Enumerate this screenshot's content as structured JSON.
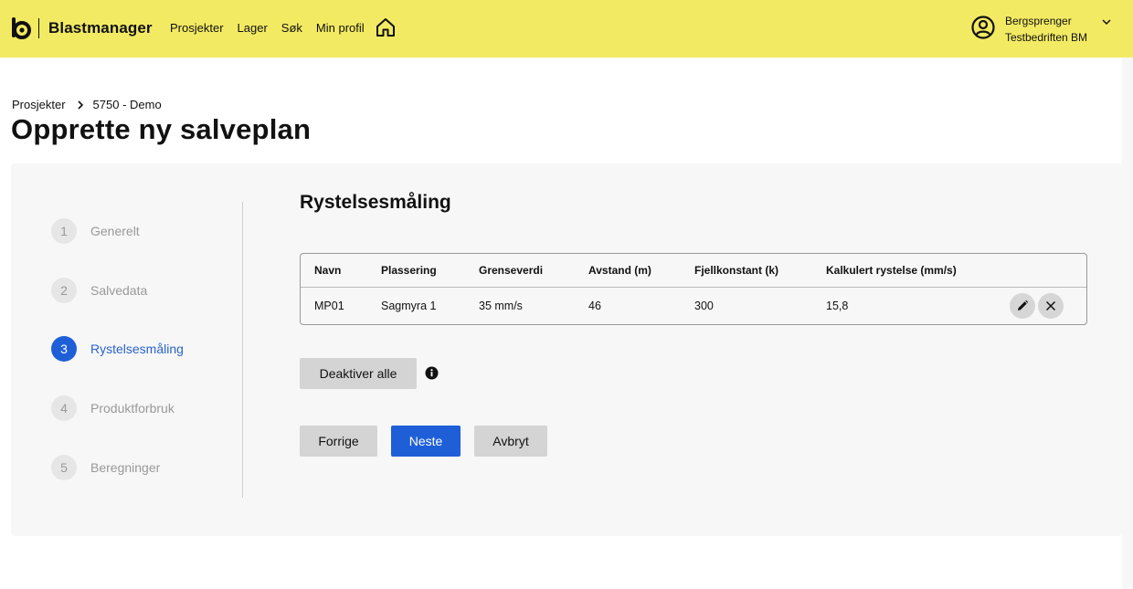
{
  "header": {
    "app_name": "Blastmanager",
    "nav": [
      "Prosjekter",
      "Lager",
      "Søk",
      "Min profil"
    ],
    "user": {
      "role": "Bergsprenger",
      "company": "Testbedriften BM"
    }
  },
  "breadcrumb": {
    "items": [
      "Prosjekter",
      "5750 - Demo"
    ]
  },
  "page_title": "Opprette ny salveplan",
  "steps": [
    {
      "num": "1",
      "label": "Generelt"
    },
    {
      "num": "2",
      "label": "Salvedata"
    },
    {
      "num": "3",
      "label": "Rystelsesmåling"
    },
    {
      "num": "4",
      "label": "Produktforbruk"
    },
    {
      "num": "5",
      "label": "Beregninger"
    }
  ],
  "active_step": 3,
  "section_title": "Rystelsesmåling",
  "table": {
    "columns": [
      "Navn",
      "Plassering",
      "Grenseverdi",
      "Avstand (m)",
      "Fjellkonstant (k)",
      "Kalkulert rystelse (mm/s)"
    ],
    "rows": [
      [
        "MP01",
        "Sagmyra 1",
        "35 mm/s",
        "46",
        "300",
        "15,8"
      ]
    ]
  },
  "buttons": {
    "deactivate_all": "Deaktiver alle",
    "previous": "Forrige",
    "next": "Neste",
    "cancel": "Avbryt"
  },
  "colors": {
    "header_bg": "#f3ea63",
    "accent": "#1e5fd8",
    "panel_bg": "#f7f7f7"
  }
}
